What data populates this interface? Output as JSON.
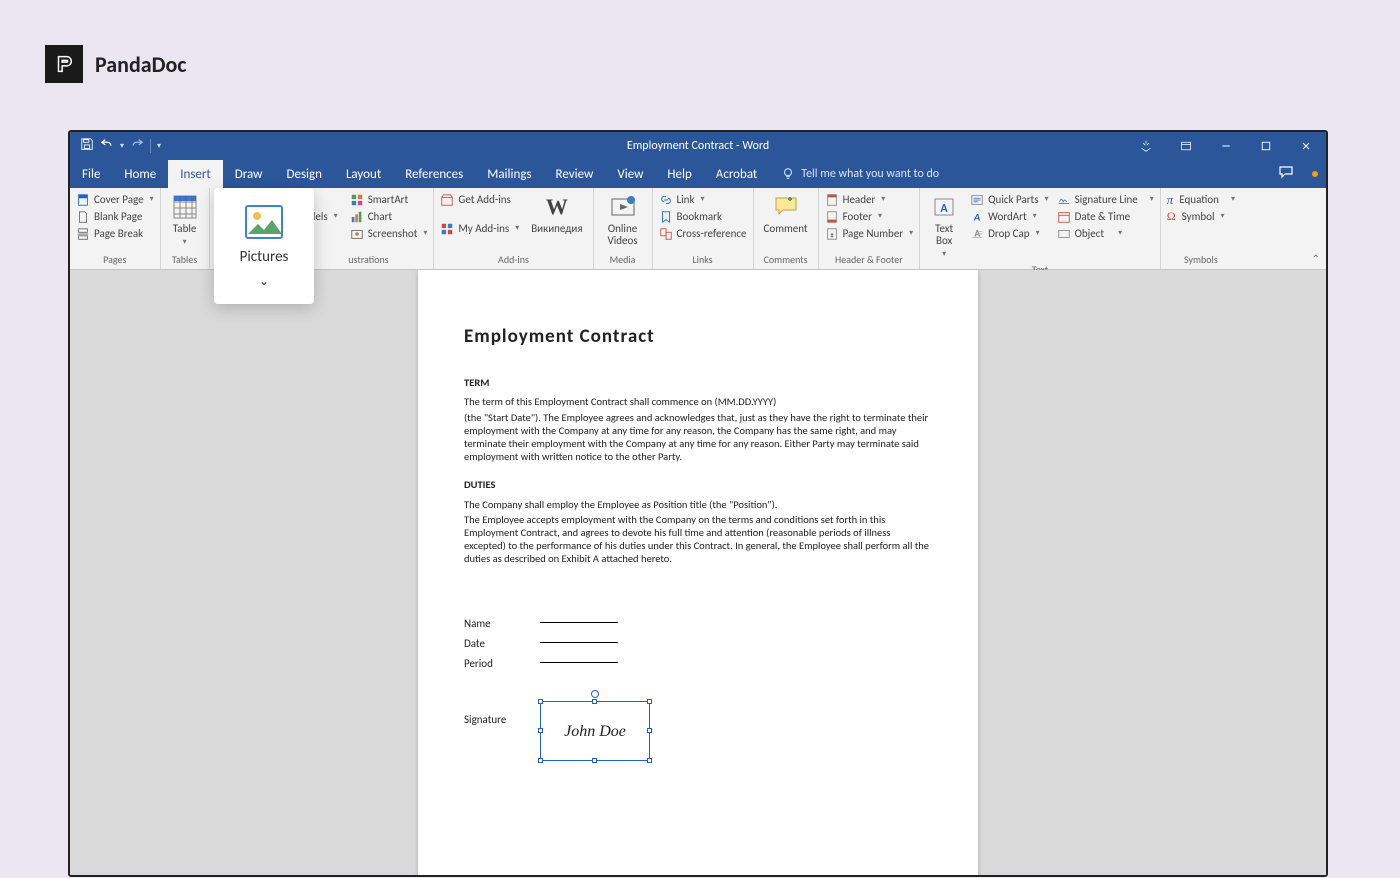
{
  "branding": {
    "name": "PandaDoc"
  },
  "titlebar": {
    "title": "Employment Contract - Word"
  },
  "menutabs": [
    "File",
    "Home",
    "Insert",
    "Draw",
    "Design",
    "Layout",
    "References",
    "Mailings",
    "Review",
    "View",
    "Help",
    "Acrobat"
  ],
  "tellme": "Tell me what you want to do",
  "ribbon": {
    "pages": {
      "cover": "Cover Page",
      "blank": "Blank Page",
      "pbreak": "Page Break",
      "label": "Pages"
    },
    "tables": {
      "table": "Table",
      "label": "Tables"
    },
    "illustrations": {
      "dels": "dels",
      "smartart": "SmartArt",
      "chart": "Chart",
      "screenshot": "Screenshot",
      "label": "ustrations"
    },
    "addins": {
      "get": "Get Add-ins",
      "my": "My Add-ins",
      "wiki": "Википедия",
      "label": "Add-ins"
    },
    "media": {
      "online": "Online Videos",
      "label": "Media"
    },
    "links": {
      "link": "Link",
      "bookmark": "Bookmark",
      "xref": "Cross-reference",
      "label": "Links"
    },
    "comments": {
      "comment": "Comment",
      "label": "Comments"
    },
    "hf": {
      "header": "Header",
      "footer": "Footer",
      "pageno": "Page Number",
      "label": "Header & Footer"
    },
    "text": {
      "textbox": "Text Box",
      "quick": "Quick Parts",
      "wordart": "WordArt",
      "dropcap": "Drop Cap",
      "sigline": "Signature Line",
      "datetime": "Date & Time",
      "object": "Object",
      "label": "Text"
    },
    "symbols": {
      "equation": "Equation",
      "symbol": "Symbol",
      "label": "Symbols"
    }
  },
  "pictures_popup": {
    "label": "Pictures"
  },
  "document": {
    "title": "Employment  Contract",
    "term_h": "TERM",
    "term_p1": "The term of this Employment Contract shall commence on (MM.DD.YYYY)",
    "term_p2": "(the \"Start Date\"). The Employee agrees and acknowledges that, just as they have the right to terminate their employment with the Company at any time for any reason, the Company has the same right, and may terminate their employment with the Company at any time for any reason. Either Party may terminate said employment with written notice to the other Party.",
    "duties_h": "DUTIES",
    "duties_p1": "The Company shall employ the Employee as Position title (the \"Position\").",
    "duties_p2": "The Employee accepts employment with the Company on the terms and conditions set forth in this Employment Contract, and agrees to devote his full time and attention (reasonable periods of illness excepted) to the performance of his duties under this Contract. In general, the Employee shall perform all the duties as described on Exhibit A attached hereto.",
    "fields": {
      "name": "Name",
      "date": "Date",
      "period": "Period",
      "signature": "Signature"
    },
    "signature_value": "John Doe"
  }
}
